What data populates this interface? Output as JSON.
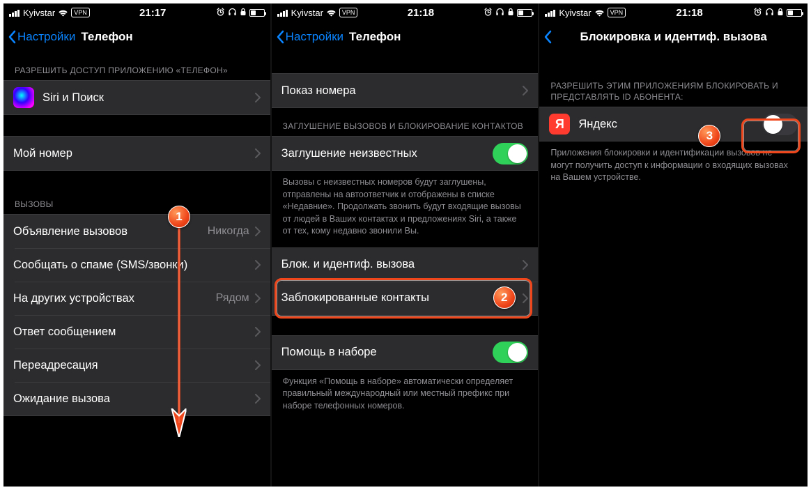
{
  "status": {
    "carrier": "Kyivstar",
    "vpn": "VPN",
    "time1": "21:17",
    "time2": "21:18",
    "time3": "21:18"
  },
  "screen1": {
    "back": "Настройки",
    "title": "Телефон",
    "sec_allow": "РАЗРЕШИТЬ ДОСТУП ПРИЛОЖЕНИЮ «ТЕЛЕФОН»",
    "siri": "Siri и Поиск",
    "mynumber": "Мой номер",
    "sec_calls": "ВЫЗОВЫ",
    "announce": {
      "label": "Объявление вызовов",
      "value": "Никогда"
    },
    "spam": "Сообщать о спаме (SMS/звонки)",
    "other": {
      "label": "На других устройствах",
      "value": "Рядом"
    },
    "reply": "Ответ сообщением",
    "forward": "Переадресация",
    "waiting": "Ожидание вызова"
  },
  "screen2": {
    "back": "Настройки",
    "title": "Телефон",
    "show": "Показ номера",
    "sec_silence": "ЗАГЛУШЕНИЕ ВЫЗОВОВ И БЛОКИРОВАНИЕ КОНТАКТОВ",
    "silence": "Заглушение неизвестных",
    "silence_footer": "Вызовы с неизвестных номеров будут заглушены, отправлены на автоответчик и отображены в списке «Недавние». Продолжать звонить будут входящие вызовы от людей в Ваших контактах и предложениях Siri, а также от тех, кому недавно звонили Вы.",
    "block_id": "Блок. и идентиф. вызова",
    "blocked": "Заблокированные контакты",
    "assist": "Помощь в наборе",
    "assist_footer": "Функция «Помощь в наборе» автоматически определяет правильный международный или местный префикс при наборе телефонных номеров."
  },
  "screen3": {
    "title": "Блокировка и идентиф. вызова",
    "sec_allow": "РАЗРЕШИТЬ ЭТИМ ПРИЛОЖЕНИЯМ БЛОКИРОВАТЬ И ПРЕДСТАВЛЯТЬ ID АБОНЕНТА:",
    "yandex": "Яндекс",
    "footer": "Приложения блокировки и идентификации вызовов не могут получить доступ к информации о входящих вызовах на Вашем устройстве."
  },
  "callouts": {
    "c1": "1",
    "c2": "2",
    "c3": "3"
  }
}
